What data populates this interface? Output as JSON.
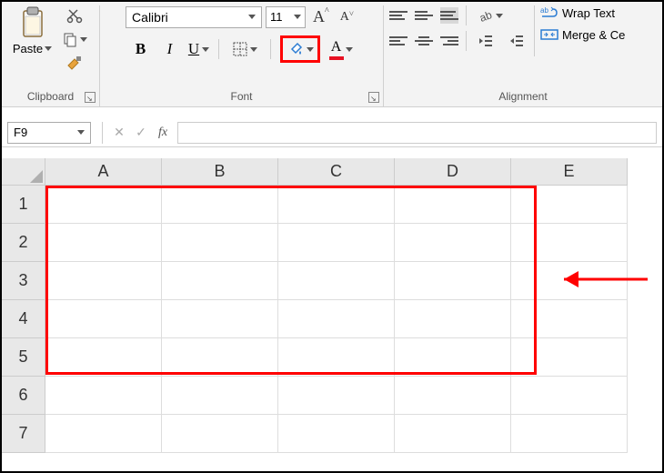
{
  "ribbon": {
    "clipboard": {
      "paste_label": "Paste",
      "group_label": "Clipboard"
    },
    "font": {
      "name": "Calibri",
      "size": "11",
      "increase_label": "A^",
      "decrease_label": "A˅",
      "bold": "B",
      "italic": "I",
      "underline": "U",
      "font_color_letter": "A",
      "group_label": "Font"
    },
    "alignment": {
      "wrap_label": "Wrap Text",
      "merge_label": "Merge & Ce",
      "group_label": "Alignment"
    }
  },
  "formula_bar": {
    "name_box": "F9",
    "fx_label": "fx",
    "formula_value": ""
  },
  "grid": {
    "columns": [
      "A",
      "B",
      "C",
      "D",
      "E"
    ],
    "rows": [
      "1",
      "2",
      "3",
      "4",
      "5",
      "6",
      "7"
    ]
  }
}
